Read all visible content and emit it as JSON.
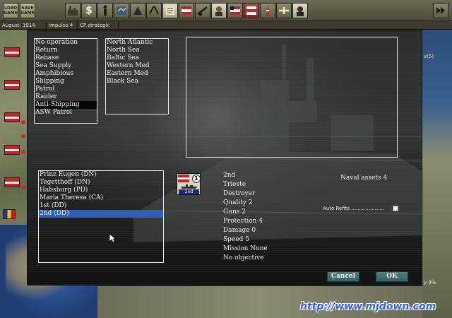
{
  "toolbar": {
    "load_game": "LOAD GAME",
    "save_game": "SAVE GAME"
  },
  "status": {
    "date": "August, 1914",
    "impulse": "Impulse 4",
    "mode": "CP strategic"
  },
  "missions": {
    "items": [
      "No operation",
      "Return",
      "Rebase",
      "Sea Supply",
      "Amphibious",
      "Shipping",
      "Patrol",
      "Raider",
      "Anti-Shipping",
      "ASW Patrol"
    ],
    "selected": "Anti-Shipping"
  },
  "regions": {
    "items": [
      "North Atlantic",
      "North Sea",
      "Baltic Sea",
      "Western Med",
      "Eastern Med",
      "Black Sea"
    ]
  },
  "units": {
    "items": [
      "Prinz Eugen (DN)",
      "Tegetthoff (DN)",
      "Habsburg (PD)",
      "Maria Theresa (CA)",
      "1st (DD)",
      "2nd (DD)"
    ],
    "selected": "2nd (DD)"
  },
  "counter": {
    "strength": "1",
    "label": "2nd"
  },
  "details": {
    "name": "2nd",
    "port": "Trieste",
    "type": "Destroyer",
    "quality": "Quality 2",
    "guns": "Guns 2",
    "protection": "Protection 4",
    "damage": "Damage 0",
    "speed": "Speed 5",
    "mission": "Mission None",
    "objective": "No objective"
  },
  "naval_assets": "Naval assets 4",
  "auto_refits": {
    "label": "Auto Refits .....................",
    "checked": false
  },
  "buttons": {
    "cancel": "Cancel",
    "ok": "OK"
  },
  "map_right": {
    "label_top": "v(5)",
    "label_bottom": "y 0%"
  },
  "watermark": "http://www.mjdown.com",
  "colors": {
    "selection_blue": "#2f5fb6",
    "button_teal": "#4d7f7c",
    "austria_red": "#c3242c"
  }
}
